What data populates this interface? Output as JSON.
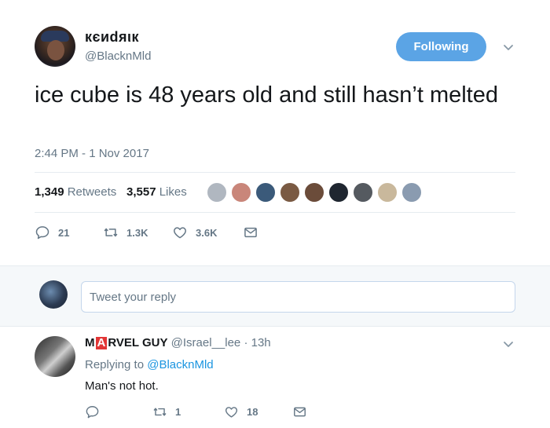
{
  "tweet": {
    "author_name": "кєиdяιк",
    "author_handle": "@BlacknMld",
    "follow_label": "Following",
    "text": "ice cube is 48 years old and still hasn’t melted",
    "timestamp": "2:44 PM - 1 Nov 2017",
    "retweets_count": "1,349",
    "retweets_label": "Retweets",
    "likes_count": "3,557",
    "likes_label": "Likes",
    "likers": [
      {
        "name": "liker-1",
        "color": "#b0b7c0"
      },
      {
        "name": "liker-2",
        "color": "#c9867a"
      },
      {
        "name": "liker-3",
        "color": "#3b5a7a"
      },
      {
        "name": "liker-4",
        "color": "#7a5a43"
      },
      {
        "name": "liker-5",
        "color": "#6b4c3a"
      },
      {
        "name": "liker-6",
        "color": "#1f2630"
      },
      {
        "name": "liker-7",
        "color": "#555a60"
      },
      {
        "name": "liker-8",
        "color": "#c9b89c"
      },
      {
        "name": "liker-9",
        "color": "#8a9bb0"
      }
    ],
    "actions": {
      "reply_count": "21",
      "retweet_count": "1.3K",
      "like_count": "3.6K"
    }
  },
  "reply_box": {
    "placeholder": "Tweet your reply"
  },
  "reply": {
    "name_prefix": "M",
    "name_boxed": "A",
    "name_suffix": "RVEL GUY",
    "handle": "@Israel__lee",
    "separator": "·",
    "time": "13h",
    "replying_to_label": "Replying to",
    "replying_to_handle": "@BlacknMld",
    "text": "Man's not hot.",
    "actions": {
      "reply_count": "",
      "retweet_count": "1",
      "like_count": "18"
    }
  },
  "colors": {
    "accent": "#1b95e0",
    "follow_button": "#5ba4e5",
    "muted": "#657786",
    "marvel_red": "#e23636"
  }
}
